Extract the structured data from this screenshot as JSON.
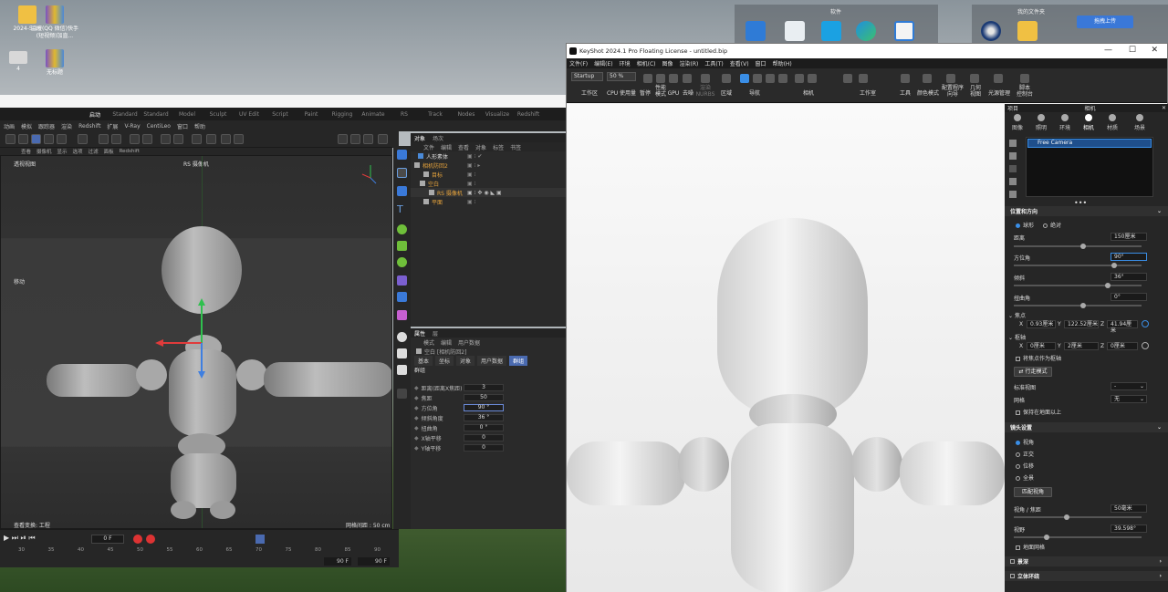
{
  "desktop": {
    "icons": [
      {
        "label": "2024-5-16",
        "icon": "folder-icon"
      },
      {
        "label": "监控(QQ 微信)快手(短视频)加直...",
        "icon": "archive-icon"
      },
      {
        "label": "4",
        "icon": "drive-icon"
      },
      {
        "label": "无标题",
        "icon": "archive-icon"
      }
    ],
    "tray_group1_label": "软件",
    "tray_group2_label": "我的文件夹",
    "upload_button": "拖拽上传"
  },
  "c4d": {
    "layout_tabs": [
      "启动",
      "Standard",
      "Standard",
      "Model",
      "Sculpt",
      "UV Edit",
      "Script",
      "Paint",
      "Rigging",
      "Animate",
      "RS",
      "Track",
      "Nodes",
      "Visualize",
      "Redshift"
    ],
    "menu": [
      "动画",
      "模拟",
      "跟踪器",
      "渲染",
      "Redshift",
      "扩展",
      "V-Ray",
      "CentiLeo",
      "窗口",
      "帮助"
    ],
    "viewport_menu": [
      "查看",
      "摄像机",
      "显示",
      "选项",
      "过滤",
      "面板",
      "Redshift"
    ],
    "viewport_name": "透视视图",
    "camera_label": "RS 摄像机",
    "move_label": "移动",
    "status_left": "查看变换: 工程",
    "status_right": "网格间距 : 50 cm",
    "object_tabs": [
      "对象",
      "场次"
    ],
    "object_menu": [
      "文件",
      "编辑",
      "查看",
      "对象",
      "标签",
      "书签"
    ],
    "objects": [
      {
        "name": "人形素体",
        "color": "#dddddd",
        "indent": 0
      },
      {
        "name": "相机防回2",
        "color": "#e6a33c",
        "indent": 0
      },
      {
        "name": "目标",
        "color": "#e6a33c",
        "indent": 1
      },
      {
        "name": "空白",
        "color": "#e6a33c",
        "indent": 1
      },
      {
        "name": "RS 摄像机",
        "color": "#e6a33c",
        "indent": 2
      },
      {
        "name": "平面",
        "color": "#e6a33c",
        "indent": 1
      }
    ],
    "attr_tabs": [
      "属性",
      "层"
    ],
    "attr_menu": [
      "模式",
      "编辑",
      "用户数据"
    ],
    "attr_title": "空白 [相机防回2]",
    "attr_subtabs": [
      "基本",
      "坐标",
      "对象",
      "用户数据",
      "群组"
    ],
    "attr_group": "群组",
    "attr_rows": [
      {
        "label": "距离(距离X焦距)",
        "value": "3"
      },
      {
        "label": "焦距",
        "value": "50"
      },
      {
        "label": "方位角",
        "value": "90 °"
      },
      {
        "label": "倾斜角度",
        "value": "36 °"
      },
      {
        "label": "扭曲角",
        "value": "0 °"
      },
      {
        "label": "X轴平移",
        "value": "0"
      },
      {
        "label": "Y轴平移",
        "value": "0"
      }
    ],
    "timeline_frame": "0 F",
    "timeline_ticks": [
      "30",
      "35",
      "40",
      "45",
      "50",
      "55",
      "60",
      "65",
      "70",
      "75",
      "80",
      "85",
      "90"
    ],
    "timeline_end1": "90 F",
    "timeline_end2": "90 F"
  },
  "keyshot": {
    "title": "KeyShot 2024.1 Pro Floating License  - untitled.bip",
    "menu": [
      "文件(F)",
      "编辑(E)",
      "环境",
      "相机(C)",
      "图像",
      "渲染(R)",
      "工具(T)",
      "查看(V)",
      "窗口",
      "帮助(H)"
    ],
    "startup": "Startup",
    "zoom": "50 %",
    "toolbar": [
      {
        "label": "工作区"
      },
      {
        "label": "CPU 使用量"
      },
      {
        "label": "暂停"
      },
      {
        "label": "性能\n模式"
      },
      {
        "label": "GPU"
      },
      {
        "label": "去噪"
      },
      {
        "label": "渲染\nNURBS"
      },
      {
        "label": "区域"
      },
      {
        "label": "导航"
      },
      {
        "label": "相机"
      },
      {
        "label": "工作室"
      },
      {
        "label": "工具"
      },
      {
        "label": "颜色模式"
      },
      {
        "label": "配置程序\n向导"
      },
      {
        "label": "几何\n视图"
      },
      {
        "label": "光源管理"
      },
      {
        "label": "脚本\n控制台"
      }
    ],
    "side": {
      "project_label": "项目",
      "panel_title": "相机",
      "tabs": [
        "图像",
        "照明",
        "环境",
        "相机",
        "材质",
        "场景"
      ],
      "camera_item": "Free Camera",
      "section_position": "位置和方向",
      "mode_options": [
        "球形",
        "绝对"
      ],
      "distance_label": "距离",
      "distance_value": "150厘米",
      "azimuth_label": "方位角",
      "azimuth_value": "90°",
      "inclination_label": "倾斜",
      "inclination_value": "36°",
      "twist_label": "扭曲角",
      "twist_value": "0°",
      "focus_label": "焦点",
      "focus_x": "0.93厘米",
      "focus_y": "122.52厘米",
      "focus_z": "41.94厘米",
      "pivot_label": "枢轴",
      "pivot_x": "0厘米",
      "pivot_y": "2厘米",
      "pivot_z": "0厘米",
      "focus_as_pivot": "将焦点作为枢轴",
      "walk_mode": "行走模式",
      "standard_view_label": "标准视图",
      "standard_view_value": "-",
      "grid_label": "网格",
      "grid_value": "无",
      "keep_above_ground": "保持在地面以上",
      "section_lens": "镜头设置",
      "lens_options": [
        "视角",
        "正交",
        "位移",
        "全景"
      ],
      "match_view": "匹配视角",
      "fov_focal_label": "视角 / 焦距",
      "fov_focal_value": "50毫米",
      "fov_label": "视野",
      "fov_value": "39.598°",
      "ground_grid": "地面网格",
      "section_dof": "景深",
      "section_stereo": "立体环绕"
    }
  }
}
